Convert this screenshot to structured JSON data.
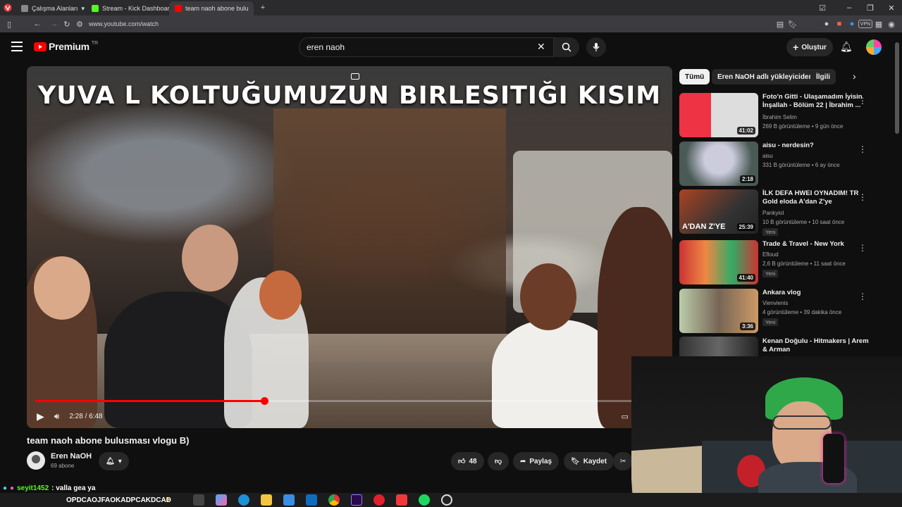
{
  "browser": {
    "tabs": [
      {
        "label": "Çalışma Alanları",
        "color": "#888888"
      },
      {
        "label": "Stream - Kick Dashboard",
        "color": "#53fc18"
      },
      {
        "label": "team naoh abone bulusma",
        "color": "#ff0000"
      }
    ],
    "url": "www.youtube.com/watch"
  },
  "header": {
    "logo_text": "Premium",
    "region": "TR",
    "search_value": "eren naoh",
    "create_label": "Oluştur"
  },
  "video": {
    "overlay_title": "YUVA L KOLTUĞUMUZUN BIRLESITIĞI KISIM",
    "time": "2:28 / 6:48",
    "progress": 0.364,
    "title": "team naoh abone bulusması vlogu B)",
    "channel": "Eren NaOH",
    "subscribers": "69 abone",
    "likes": "48",
    "share_label": "Paylaş",
    "save_label": "Kaydet"
  },
  "chips": [
    "Tümü",
    "Eren NaOH adlı yükleyiciden",
    "İlgili"
  ],
  "recommendations": [
    {
      "title": "Foto'n Gitti - Ulaşamadım İyisin İnşallah - Bölüm 22 | İbrahim ...",
      "channel": "İbrahim Selim",
      "meta": "269 B görüntüleme • 9 gün önce",
      "duration": "41:02",
      "badge": ""
    },
    {
      "title": "aisu - nerdesin?",
      "channel": "aisu",
      "meta": "331 B görüntüleme • 6 ay önce",
      "duration": "2:18",
      "badge": ""
    },
    {
      "title": "İLK DEFA HWEI OYNADIM! TR Gold eloda A'dan Z'ye",
      "channel": "Pankyiol",
      "meta": "10 B görüntüleme • 10 saat önce",
      "duration": "25:39",
      "badge": "Yeni"
    },
    {
      "title": "Trade & Travel - New York",
      "channel": "Efloud",
      "meta": "2,6 B görüntüleme • 11 saat önce",
      "duration": "41:40",
      "badge": "Yeni"
    },
    {
      "title": "Ankara vlog",
      "channel": "Vienvienis",
      "meta": "4 görüntüleme • 39 dakika önce",
      "duration": "3:36",
      "badge": "Yeni"
    },
    {
      "title": "Kenan Doğulu - Hitmakers | Arem & Arman",
      "channel": "",
      "meta": "",
      "duration": "",
      "badge": ""
    }
  ],
  "chat": {
    "user": "seyit1452",
    "message": ": valla gea ya",
    "ticker": "OPDCAOJFAOKADPCAKDCAD"
  },
  "colors": {
    "background": "#0f0f0f",
    "accent": "#ff0000"
  }
}
